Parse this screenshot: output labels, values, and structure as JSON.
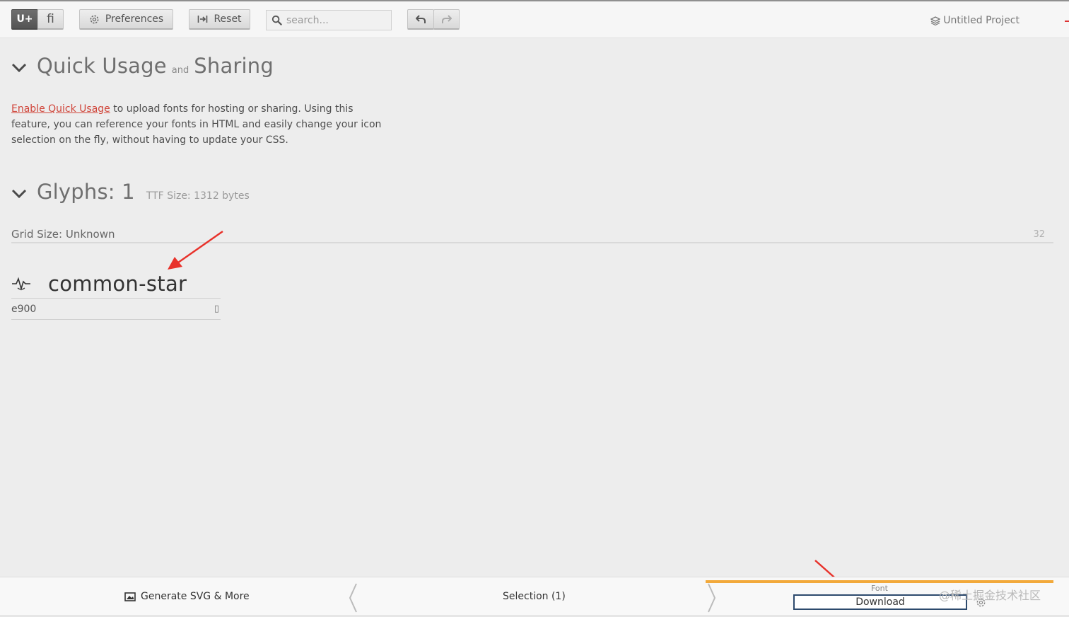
{
  "toolbar": {
    "mode_unicode": "U+",
    "mode_ligature": "ﬁ",
    "preferences": "Preferences",
    "reset": "Reset",
    "search_placeholder": "search...",
    "project_name": "Untitled Project"
  },
  "quick_usage": {
    "title_part1": "Quick Usage",
    "title_and": "and",
    "title_part2": "Sharing",
    "enable_link": "Enable Quick Usage",
    "description": " to upload fonts for hosting or sharing. Using this feature, you can reference your fonts in HTML and easily change your icon selection on the fly, without having to update your CSS."
  },
  "glyphs": {
    "title": "Glyphs: 1",
    "ttf_size": "TTF Size: 1312 bytes",
    "grid_size": "Grid Size: Unknown",
    "grid_value": "32",
    "items": [
      {
        "name": "common-star",
        "code": "e900",
        "char": "▯"
      }
    ]
  },
  "bottombar": {
    "generate": "Generate SVG & More",
    "selection": "Selection (1)",
    "font_label": "Font",
    "download": "Download",
    "watermark": "@稀土掘金技术社区"
  },
  "colors": {
    "accent": "#f2a93b",
    "link": "#d0453a",
    "download_border": "#2d4a6d",
    "annotation_arrow": "#e8322b"
  }
}
